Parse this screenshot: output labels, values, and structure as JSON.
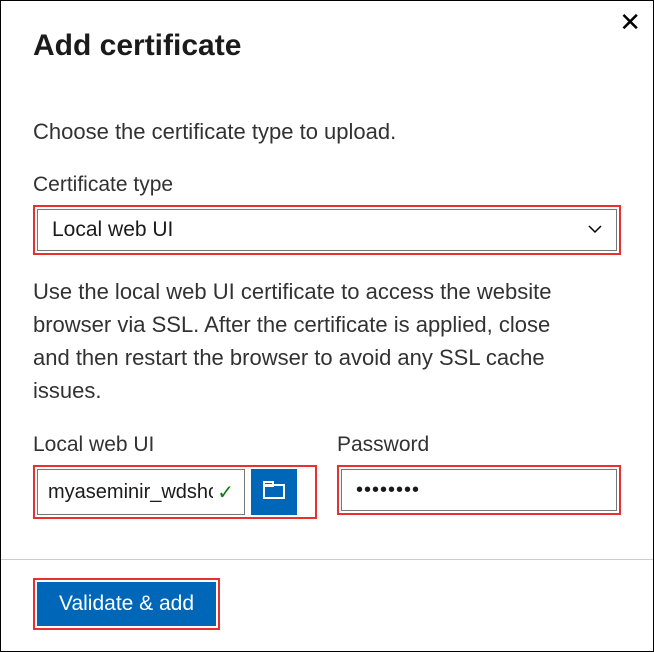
{
  "dialog": {
    "title": "Add certificate",
    "instruction": "Choose the certificate type to upload.",
    "cert_type_label": "Certificate type",
    "cert_type_value": "Local web UI",
    "description": "Use the local web UI certificate to access the website browser via SSL. After the certificate is applied, close and then restart the browser to avoid any SSL cache issues.",
    "file_label": "Local web UI",
    "file_value": "myaseminir_wdshc",
    "password_label": "Password",
    "password_value": "••••••••",
    "submit_label": "Validate & add"
  },
  "icons": {
    "close": "✕",
    "chevron_down": "⌄",
    "check": "✓"
  }
}
